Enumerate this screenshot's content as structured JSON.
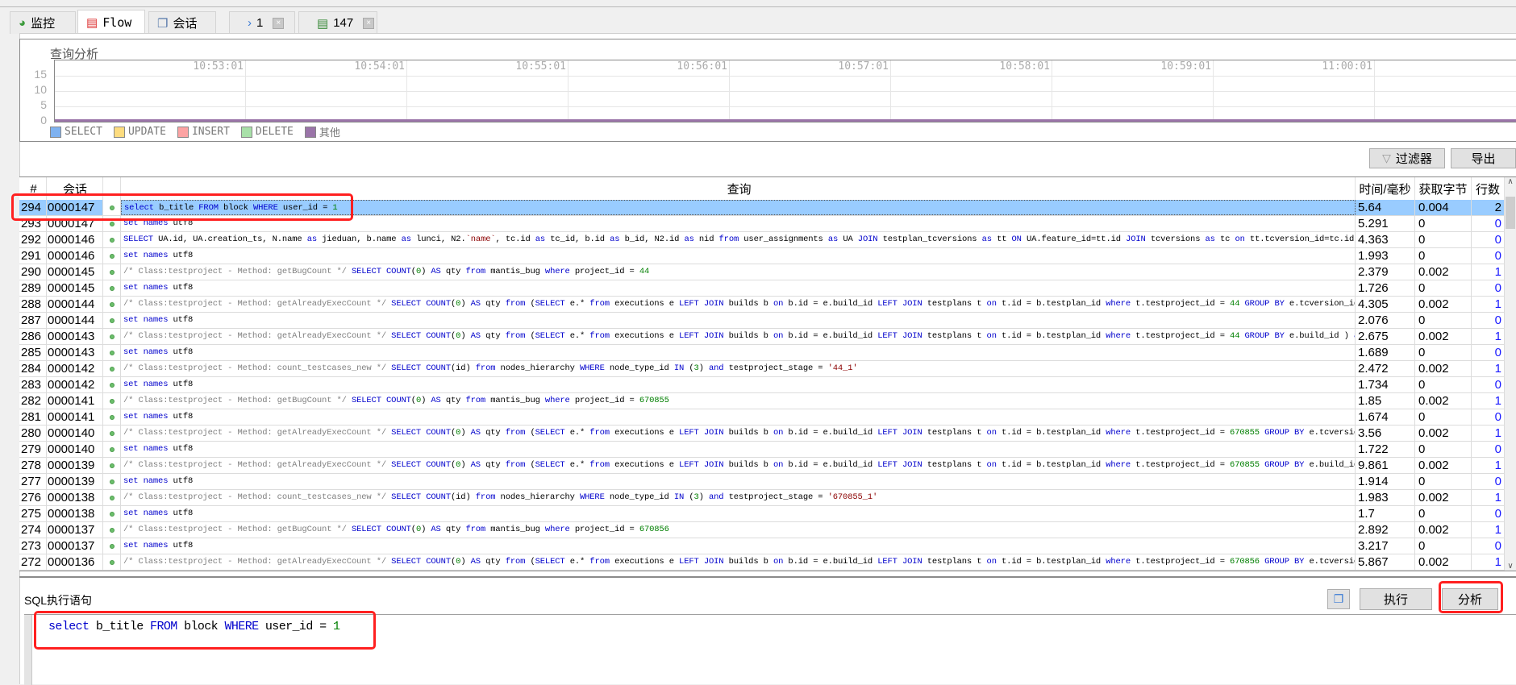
{
  "tabs": [
    {
      "label": "监控",
      "icon": "monitor-pie-icon"
    },
    {
      "label": "Flow",
      "icon": "flow-icon",
      "active": true
    },
    {
      "label": "会话",
      "icon": "session-icon"
    },
    {
      "label": "1",
      "icon": "console-arrow-icon",
      "closable": true
    },
    {
      "label": "147",
      "icon": "connection-icon",
      "closable": true
    }
  ],
  "chart_data": {
    "type": "line",
    "title": "查询分析",
    "x": [
      "10:53:01",
      "10:54:01",
      "10:55:01",
      "10:56:01",
      "10:57:01",
      "10:58:01",
      "10:59:01",
      "11:00:01"
    ],
    "yticks": [
      0,
      5,
      10,
      15
    ],
    "ylim": [
      0,
      20
    ],
    "grid": true,
    "legend_position": "bottom-left",
    "series": [
      {
        "name": "SELECT",
        "color": "#7fb2f0",
        "values": [
          0,
          0,
          0,
          0,
          0,
          0,
          0,
          0
        ]
      },
      {
        "name": "UPDATE",
        "color": "#fddc7f",
        "values": [
          0,
          0,
          0,
          0,
          0,
          0,
          0,
          0
        ]
      },
      {
        "name": "INSERT",
        "color": "#fca3a3",
        "values": [
          0,
          0,
          0,
          0,
          0,
          0,
          0,
          0
        ]
      },
      {
        "name": "DELETE",
        "color": "#a8e0a8",
        "values": [
          0,
          0,
          0,
          0,
          0,
          0,
          0,
          0
        ]
      },
      {
        "name": "其他",
        "color": "#9a74a8",
        "values": [
          0,
          0,
          0,
          0,
          0,
          0,
          0,
          0
        ]
      }
    ]
  },
  "toolbar": {
    "filter_label": "过滤器",
    "export_label": "导出"
  },
  "table": {
    "headers": [
      "#",
      "会话",
      "",
      "查询",
      "时间/毫秒",
      "获取字节",
      "行数"
    ],
    "rows": [
      {
        "n": "294",
        "s": "0000147",
        "q": "select b_title FROM block WHERE user_id = 1",
        "t": "5.64",
        "b": "0.004",
        "r": "2",
        "selected": true
      },
      {
        "n": "293",
        "s": "0000147",
        "q": "set names utf8",
        "t": "5.291",
        "b": "0",
        "r": "0"
      },
      {
        "n": "292",
        "s": "0000146",
        "q": "SELECT UA.id, UA.creation_ts, N.name as jieduan, b.name as lunci, N2.`name`, tc.id as tc_id, b.id as b_id, N2.id as nid from user_assignments as UA JOIN testplan_tcversions as tt ON UA.feature_id=tt.id JOIN tcversions as tc on tt.tcversion_id=tc.id J  ...",
        "t": "4.363",
        "b": "0",
        "r": "0"
      },
      {
        "n": "291",
        "s": "0000146",
        "q": "set names utf8",
        "t": "1.993",
        "b": "0",
        "r": "0"
      },
      {
        "n": "290",
        "s": "0000145",
        "q": "/* Class:testproject - Method: getBugCount */ SELECT COUNT(0) AS qty from mantis_bug where project_id = 44",
        "t": "2.379",
        "b": "0.002",
        "r": "1"
      },
      {
        "n": "289",
        "s": "0000145",
        "q": "set names utf8",
        "t": "1.726",
        "b": "0",
        "r": "0"
      },
      {
        "n": "288",
        "s": "0000144",
        "q": "/* Class:testproject - Method: getAlreadyExecCount */ SELECT COUNT(0) AS qty from (SELECT e.* from executions e LEFT JOIN builds b on b.id = e.build_id LEFT JOIN testplans t on t.id = b.testplan_id where t.testproject_id = 44 GROUP BY e.tcversion_id   ...",
        "t": "4.305",
        "b": "0.002",
        "r": "1"
      },
      {
        "n": "287",
        "s": "0000144",
        "q": "set names utf8",
        "t": "2.076",
        "b": "0",
        "r": "0"
      },
      {
        "n": "286",
        "s": "0000143",
        "q": "/* Class:testproject - Method: getAlreadyExecCount */ SELECT COUNT(0) AS qty from (SELECT e.* from executions e LEFT JOIN builds b on b.id = e.build_id LEFT JOIN testplans t on t.id = b.testplan_id where t.testproject_id = 44 GROUP BY e.build_id ) as  ...",
        "t": "2.675",
        "b": "0.002",
        "r": "1"
      },
      {
        "n": "285",
        "s": "0000143",
        "q": "set names utf8",
        "t": "1.689",
        "b": "0",
        "r": "0"
      },
      {
        "n": "284",
        "s": "0000142",
        "q": "/* Class:testproject - Method: count_testcases_new */ SELECT COUNT(id) from nodes_hierarchy WHERE node_type_id IN (3) and testproject_stage = '44_1'",
        "t": "2.472",
        "b": "0.002",
        "r": "1"
      },
      {
        "n": "283",
        "s": "0000142",
        "q": "set names utf8",
        "t": "1.734",
        "b": "0",
        "r": "0"
      },
      {
        "n": "282",
        "s": "0000141",
        "q": "/* Class:testproject - Method: getBugCount */ SELECT COUNT(0) AS qty from mantis_bug where project_id = 670855",
        "t": "1.85",
        "b": "0.002",
        "r": "1"
      },
      {
        "n": "281",
        "s": "0000141",
        "q": "set names utf8",
        "t": "1.674",
        "b": "0",
        "r": "0"
      },
      {
        "n": "280",
        "s": "0000140",
        "q": "/* Class:testproject - Method: getAlreadyExecCount */ SELECT COUNT(0) AS qty from (SELECT e.* from executions e LEFT JOIN builds b on b.id = e.build_id LEFT JOIN testplans t on t.id = b.testplan_id where t.testproject_id = 670855 GROUP BY e.tcversion  ...",
        "t": "3.56",
        "b": "0.002",
        "r": "1"
      },
      {
        "n": "279",
        "s": "0000140",
        "q": "set names utf8",
        "t": "1.722",
        "b": "0",
        "r": "0"
      },
      {
        "n": "278",
        "s": "0000139",
        "q": "/* Class:testproject - Method: getAlreadyExecCount */ SELECT COUNT(0) AS qty from (SELECT e.* from executions e LEFT JOIN builds b on b.id = e.build_id LEFT JOIN testplans t on t.id = b.testplan_id where t.testproject_id = 670855 GROUP BY e.build_id   ...",
        "t": "9.861",
        "b": "0.002",
        "r": "1"
      },
      {
        "n": "277",
        "s": "0000139",
        "q": "set names utf8",
        "t": "1.914",
        "b": "0",
        "r": "0"
      },
      {
        "n": "276",
        "s": "0000138",
        "q": "/* Class:testproject - Method: count_testcases_new */ SELECT COUNT(id) from nodes_hierarchy WHERE node_type_id IN (3) and testproject_stage = '670855_1'",
        "t": "1.983",
        "b": "0.002",
        "r": "1"
      },
      {
        "n": "275",
        "s": "0000138",
        "q": "set names utf8",
        "t": "1.7",
        "b": "0",
        "r": "0"
      },
      {
        "n": "274",
        "s": "0000137",
        "q": "/* Class:testproject - Method: getBugCount */ SELECT COUNT(0) AS qty from mantis_bug where project_id = 670856",
        "t": "2.892",
        "b": "0.002",
        "r": "1"
      },
      {
        "n": "273",
        "s": "0000137",
        "q": "set names utf8",
        "t": "3.217",
        "b": "0",
        "r": "0"
      },
      {
        "n": "272",
        "s": "0000136",
        "q": "/* Class:testproject - Method: getAlreadyExecCount */ SELECT COUNT(0) AS qty from (SELECT e.* from executions e LEFT JOIN builds b on b.id = e.build_id LEFT JOIN testplans t on t.id = b.testplan_id where t.testproject_id = 670856 GROUP BY e.tcversion  ...",
        "t": "5.867",
        "b": "0.002",
        "r": "1"
      }
    ]
  },
  "sql_panel": {
    "label": "SQL执行语句",
    "execute_label": "执行",
    "analyze_label": "分析",
    "copy_icon": "copy-icon",
    "editor_value": "select  b_title FROM block WHERE user_id = 1"
  }
}
